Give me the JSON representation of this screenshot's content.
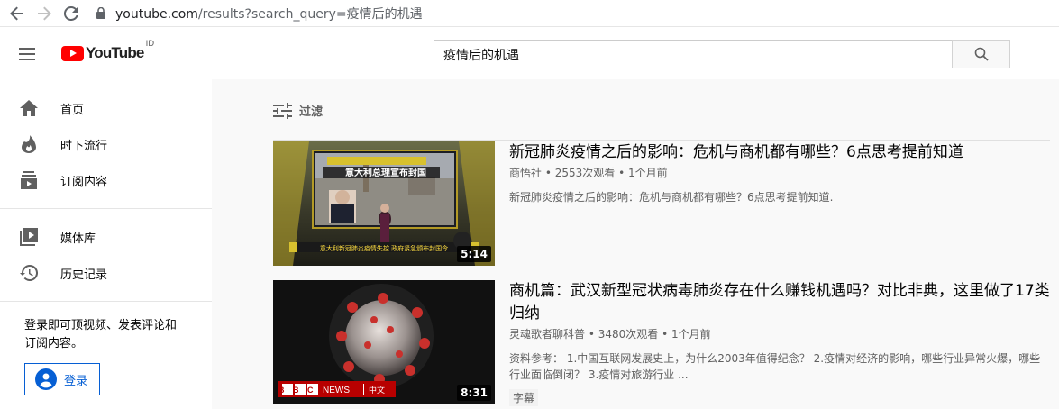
{
  "browser": {
    "url_domain": "youtube.com",
    "url_path": "/results?search_query=疫情后的机遇"
  },
  "header": {
    "logo_text": "YouTube",
    "region": "ID",
    "search_value": "疫情后的机遇"
  },
  "sidebar": {
    "items": [
      {
        "label": "首页",
        "icon": "home-icon"
      },
      {
        "label": "时下流行",
        "icon": "trending-icon"
      },
      {
        "label": "订阅内容",
        "icon": "subscriptions-icon"
      },
      {
        "label": "媒体库",
        "icon": "library-icon"
      },
      {
        "label": "历史记录",
        "icon": "history-icon"
      }
    ],
    "signin_text": "登录即可顶视频、发表评论和订阅内容。",
    "signin_button": "登录"
  },
  "filter": {
    "label": "过滤"
  },
  "videos": [
    {
      "title": "新冠肺炎疫情之后的影响：危机与商机都有哪些？6点思考提前知道",
      "channel": "商悟社",
      "views": "2553次观看",
      "age": "1个月前",
      "description": "新冠肺炎疫情之后的影响：危机与商机都有哪些？6点思考提前知道.",
      "duration": "5:14",
      "thumb_caption_top": "意大利总理宣布封国",
      "thumb_caption_bottom": "意大利新冠肺炎疫情失控 政府紧急颁布封国令"
    },
    {
      "title": "商机篇：武汉新型冠状病毒肺炎存在什么赚钱机遇吗？对比非典，这里做了17类归纳",
      "channel": "灵魂歌者聊科普",
      "views": "3480次观看",
      "age": "1个月前",
      "description": "资料参考： 1.中国互联网发展史上，为什么2003年值得纪念？ 2.疫情对经济的影响，哪些行业异常火爆，哪些行业面临倒闭？ 3.疫情对旅游行业 ...",
      "duration": "8:31",
      "badge": "字幕",
      "thumb_brand": "BBC",
      "thumb_news": "NEWS",
      "thumb_lang": "中文"
    }
  ]
}
